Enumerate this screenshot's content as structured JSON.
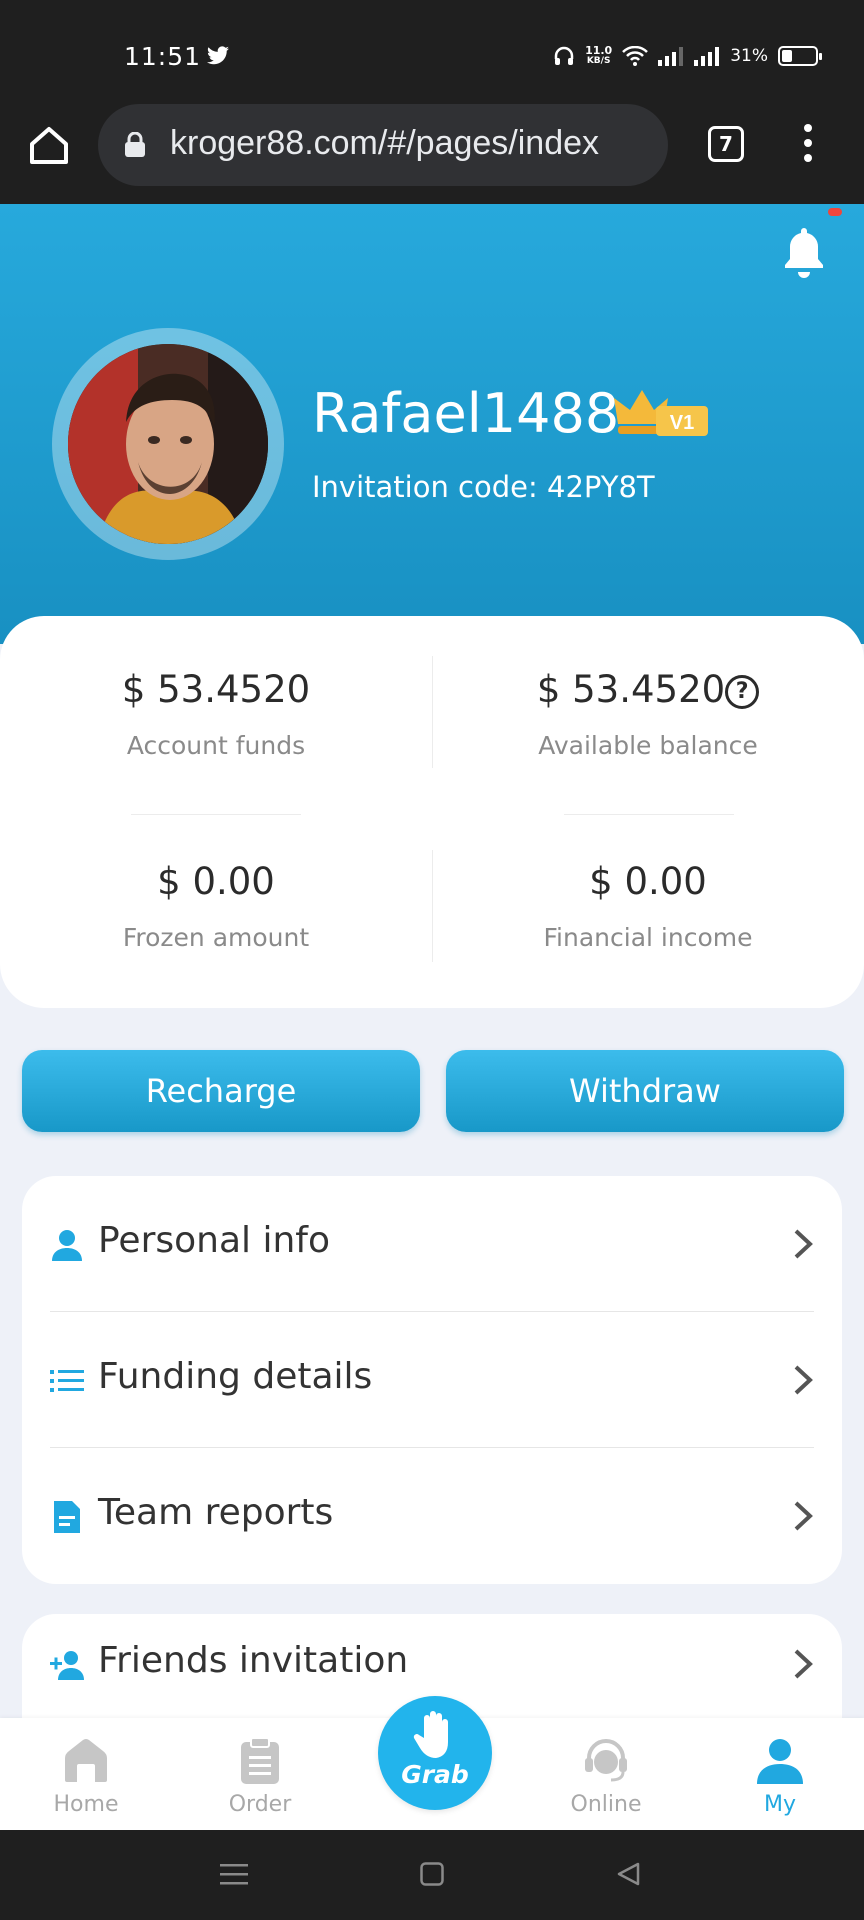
{
  "status_bar": {
    "time": "11:51",
    "net_speed_value": "11.0",
    "net_speed_unit": "KB/S",
    "battery_percent": "31%",
    "battery_level": 0.31
  },
  "browser": {
    "url": "kroger88.com/#/pages/index",
    "tab_count": "7"
  },
  "profile": {
    "username": "Rafael1488",
    "vip_badge": "V1",
    "invitation_code": "Invitation code: 42PY8T"
  },
  "funds": {
    "account_funds_value": "$ 53.4520",
    "account_funds_label": "Account funds",
    "available_balance_value": "$ 53.4520",
    "available_balance_help": "?",
    "available_balance_label": "Available balance",
    "frozen_amount_value": "$ 0.00",
    "frozen_amount_label": "Frozen amount",
    "financial_income_value": "$ 0.00",
    "financial_income_label": "Financial income"
  },
  "actions": {
    "recharge": "Recharge",
    "withdraw": "Withdraw"
  },
  "menu": {
    "personal_info": "Personal info",
    "funding_details": "Funding details",
    "team_reports": "Team reports",
    "friends_invitation": "Friends invitation"
  },
  "tabbar": {
    "home": "Home",
    "order": "Order",
    "grab": "Grab",
    "online": "Online",
    "my": "My"
  },
  "colors": {
    "brand": "#21a8e0",
    "hero_top": "#27a9dc",
    "hero_bottom": "#1890c2",
    "page_bg": "#eef1f8",
    "notification_dot": "#f0463c"
  }
}
